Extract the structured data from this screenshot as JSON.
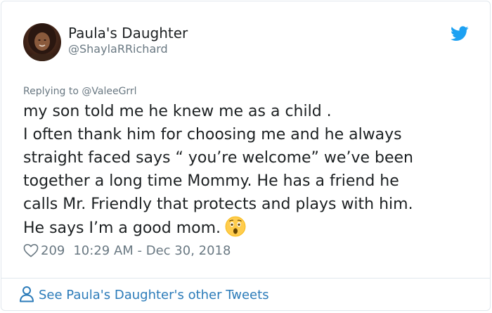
{
  "author": {
    "name": "Paula's Daughter",
    "handle": "@ShaylaRRichard"
  },
  "reply": {
    "text": "Replying to @ValeeGrrl"
  },
  "tweet": {
    "lines": [
      "my son told me he knew me as a child .",
      "I often thank him for choosing me and he always",
      "straight faced says “ you’re welcome” we’ve been",
      "together a long time Mommy. He has a friend he",
      "calls Mr. Friendly that protects and plays with him.",
      "He says I’m a good mom."
    ],
    "emoji": "astonished-face-emoji"
  },
  "meta": {
    "likes": "209",
    "timestamp": "10:29 AM - Dec 30, 2018"
  },
  "footer": {
    "link_label": "See Paula's Daughter's other Tweets"
  },
  "icons": {
    "brand": "twitter-bird-icon",
    "like": "heart-icon",
    "profile": "person-icon"
  },
  "colors": {
    "twitter_blue": "#1da1f2",
    "link_blue": "#2b7bb9",
    "text": "#1c2022",
    "muted": "#697882",
    "border": "#e1e8ed"
  }
}
